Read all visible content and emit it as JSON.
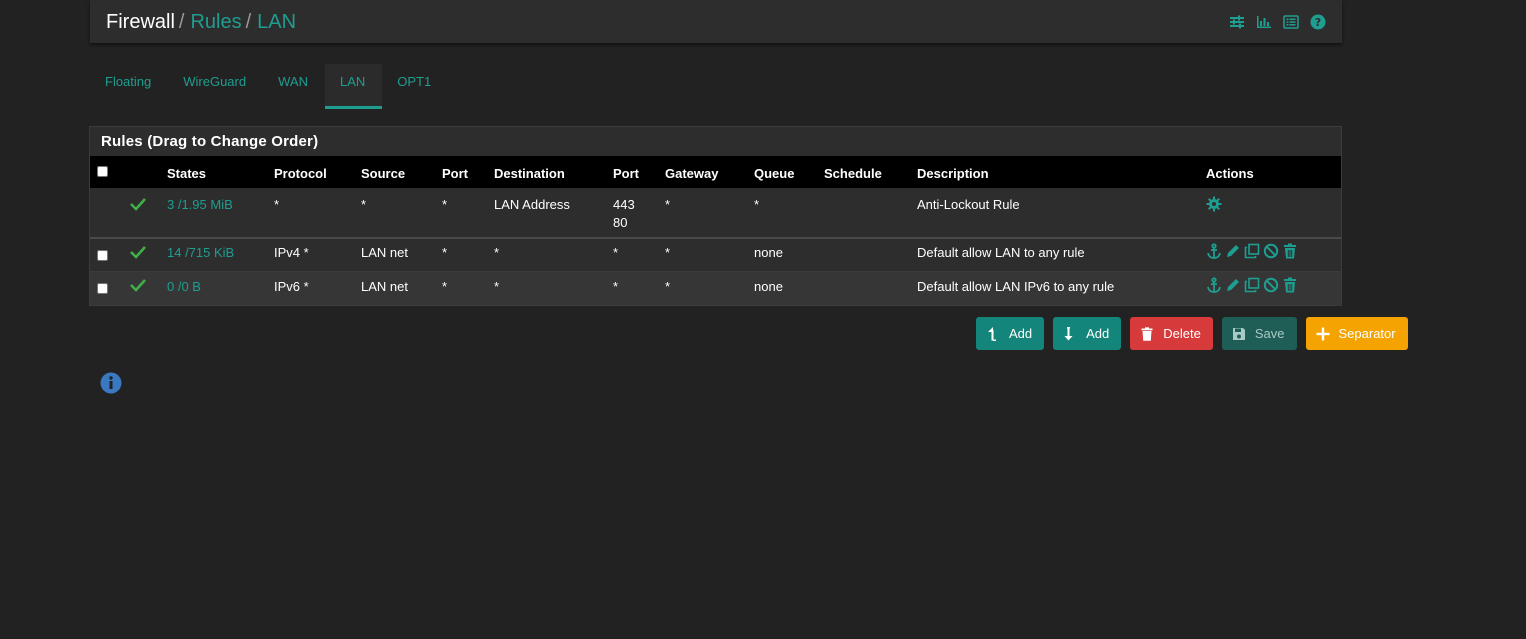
{
  "breadcrumb": {
    "root": "Firewall",
    "sep": "/",
    "rules": "Rules",
    "current": "LAN"
  },
  "header_icons": [
    "sliders-icon",
    "bar-chart-icon",
    "list-icon",
    "help-icon"
  ],
  "tabs": [
    {
      "label": "Floating",
      "active": false
    },
    {
      "label": "WireGuard",
      "active": false
    },
    {
      "label": "WAN",
      "active": false
    },
    {
      "label": "LAN",
      "active": true
    },
    {
      "label": "OPT1",
      "active": false
    }
  ],
  "panel": {
    "title": "Rules (Drag to Change Order)"
  },
  "columns": {
    "states": "States",
    "protocol": "Protocol",
    "source": "Source",
    "port": "Port",
    "destination": "Destination",
    "port2": "Port",
    "gateway": "Gateway",
    "queue": "Queue",
    "schedule": "Schedule",
    "description": "Description",
    "actions": "Actions"
  },
  "rows": [
    {
      "states": "3 /1.95 MiB",
      "protocol": "*",
      "source": "*",
      "port": "*",
      "destination": "LAN Address",
      "dport_line1": "443",
      "dport_line2": "80",
      "gateway": "*",
      "queue": "*",
      "schedule": "",
      "description": "Anti-Lockout Rule",
      "has_checkbox": false
    },
    {
      "states": "14 /715 KiB",
      "protocol": "IPv4 *",
      "source": "LAN net",
      "port": "*",
      "destination": "*",
      "dport": "*",
      "gateway": "*",
      "queue": "none",
      "schedule": "",
      "description": "Default allow LAN to any rule",
      "has_checkbox": true
    },
    {
      "states": "0 /0 B",
      "protocol": "IPv6 *",
      "source": "LAN net",
      "port": "*",
      "destination": "*",
      "dport": "*",
      "gateway": "*",
      "queue": "none",
      "schedule": "",
      "description": "Default allow LAN IPv6 to any rule",
      "has_checkbox": true
    }
  ],
  "buttons": {
    "add_top": "Add",
    "add_bottom": "Add",
    "delete": "Delete",
    "save": "Save",
    "separator": "Separator"
  },
  "colors": {
    "accent": "#1e9e90",
    "background": "#222222",
    "panel": "#2d2d2d",
    "delete": "#d73a3a",
    "separator": "#f5a300",
    "check": "#3fae49",
    "info": "#3a78c2"
  }
}
